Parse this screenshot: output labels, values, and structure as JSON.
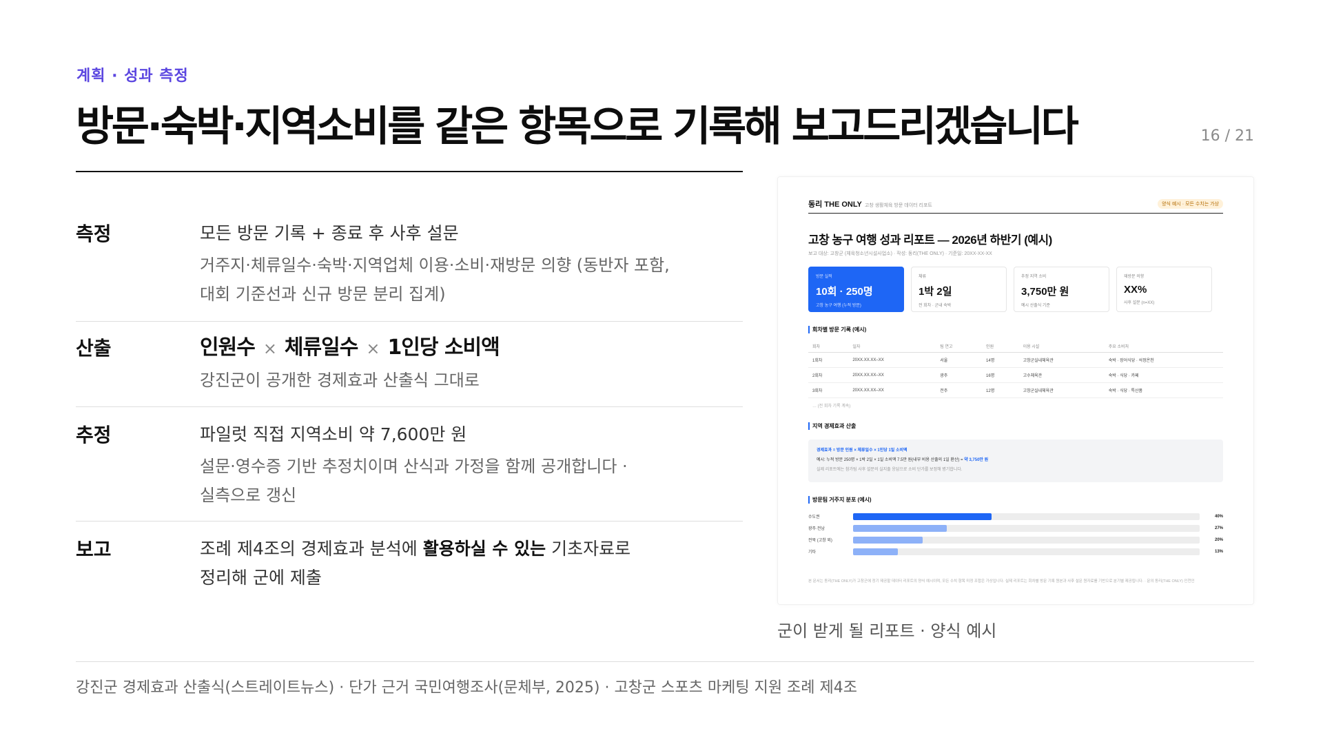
{
  "eyebrow": "계획 · 성과 측정",
  "title": "방문·숙박·지역소비를 같은 항목으로 기록해 보고드리겠습니다",
  "page_number": "16 / 21",
  "rows": [
    {
      "label": "측정",
      "line": "모든 방문 기록 + 종료 후 사후 설문",
      "sub1": "거주지·체류일수·숙박·지역업체 이용·소비·재방문 의향 (동반자 포함,",
      "sub2": "대회 기준선과 신규 방문 분리 집계)"
    },
    {
      "label": "산출",
      "formula": [
        "인원수",
        "체류일수",
        "1인당 소비액"
      ],
      "times": "×",
      "sub1": "강진군이 공개한 경제효과 산출식 그대로"
    },
    {
      "label": "추정",
      "line": "파일럿 직접 지역소비 약 7,600만 원",
      "sub1": "설문·영수증 기반 추정치이며 산식과 가정을 함께 공개합니다 ·",
      "sub2": "실측으로 갱신"
    },
    {
      "label": "보고",
      "line_pre": "조례 제4조의 경제효과 분석에 ",
      "line_bold": "활용하실 수 있는",
      "line_post": " 기초자료로",
      "line2": "정리해 군에 제출"
    }
  ],
  "report": {
    "brand": "동리 THE ONLY",
    "brand_sub": "고창 생활체육 방문 데이터 리포트",
    "pill": "양식 예시 · 모든 수치는 가상",
    "title": "고창 농구 여행 성과 리포트 — 2026년 하반기 (예시)",
    "meta": "보고 대상: 고창군 (체육청소년시설사업소) · 작성: 동리(THE ONLY) · 기준일: 20XX-XX-XX",
    "kpis": [
      {
        "label": "방문 실적",
        "value": "10회 · 250명",
        "note": "고창 농구 여행 (누적 방문)"
      },
      {
        "label": "체류",
        "value": "1박 2일",
        "note": "전 회차 · 군내 숙박"
      },
      {
        "label": "추정 지역 소비",
        "value": "3,750만 원",
        "note": "예시 산출식 기준"
      },
      {
        "label": "재방문 의향",
        "value": "XX%",
        "note": "사후 설문 (n=XX)"
      }
    ],
    "visits_title": "회차별 방문 기록 (예시)",
    "visits_headers": [
      "회차",
      "일자",
      "팀 연고",
      "인원",
      "이용 시설",
      "주요 소비처"
    ],
    "visits": [
      [
        "1회차",
        "20XX.XX.XX–XX",
        "서울",
        "14명",
        "고창군실내체육관",
        "숙박 · 장어식당 · 석정온천"
      ],
      [
        "2회차",
        "20XX.XX.XX–XX",
        "광주",
        "16명",
        "고수체육관",
        "숙박 · 식당 · 카페"
      ],
      [
        "3회차",
        "20XX.XX.XX–XX",
        "전주",
        "12명",
        "고창군실내체육관",
        "숙박 · 식당 · 특산품"
      ]
    ],
    "visits_more": "… (전 회차 기록 계속)",
    "econ_title": "지역 경제효과 산출",
    "econ_formula": "경제효과 = 방문 인원 × 체류일수 × 1인당 1일 소비액",
    "econ_example_pre": "예시: 누적 방문 250명 × 1박 2일 × 1일 소비액 7.5만 원(내부 비용 산출의 1일 환산) = ",
    "econ_example_bold": "약 3,750만 원",
    "econ_note": "실제 리포트에는 참가팀 사후 설문의 실지출 응답으로 소비 단가를 보정해 병기합니다.",
    "dist_title": "방문팀 거주지 분포 (예시)",
    "dist": [
      {
        "label": "수도권",
        "value": 40,
        "pct": "40%"
      },
      {
        "label": "광주·전남",
        "value": 27,
        "pct": "27%"
      },
      {
        "label": "전북 (고창 외)",
        "value": 20,
        "pct": "20%"
      },
      {
        "label": "기타",
        "value": 13,
        "pct": "13%"
      }
    ],
    "dist_colors": [
      "#1e66f5",
      "#8db1f8",
      "#8db1f8",
      "#8db1f8"
    ],
    "footnote": "본 문서는 동리(THE ONLY)가 고창군에 정기 제공할 데이터 리포트의 양식 예시이며, 모든 수치 항목 미정 조합은 가상입니다. 실제 리포트는 회차별 방문 기록 원본과 사후 설문 원자료를 기반으로 분기별 제공됩니다. · 문의 동리(THE ONLY) 인천인"
  },
  "caption": "군이 받게 될 리포트 · 양식 예시",
  "source": "강진군 경제효과 산출식(스트레이트뉴스) · 단가 근거 국민여행조사(문체부, 2025) · 고창군 스포츠 마케팅 지원 조례 제4조"
}
